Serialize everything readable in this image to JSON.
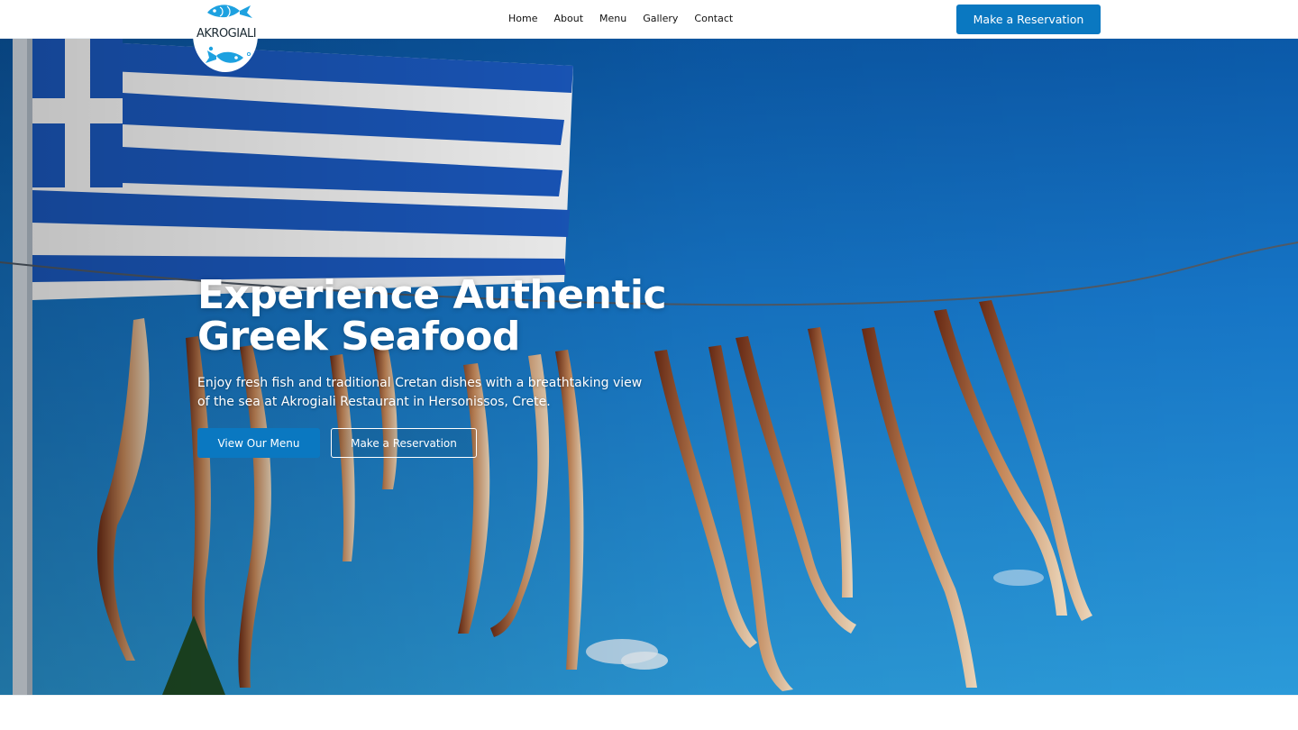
{
  "brand": {
    "name": "AKROGIALI",
    "accent": "#0a78c1",
    "logo_icon": "fish-icon"
  },
  "nav": {
    "items": [
      {
        "label": "Home"
      },
      {
        "label": "About"
      },
      {
        "label": "Menu"
      },
      {
        "label": "Gallery"
      },
      {
        "label": "Contact"
      }
    ],
    "cta_label": "Make a Reservation"
  },
  "hero": {
    "title_line1": "Experience Authentic",
    "title_line2": "Greek Seafood",
    "subtitle": "Enjoy fresh fish and traditional Cretan dishes with a breathtaking view of the sea at Akrogiali Restaurant in Hersonissos, Crete.",
    "primary_button": "View Our Menu",
    "secondary_button": "Make a Reservation",
    "background": "Greek flag and octopus drying on a line against blue sky"
  }
}
